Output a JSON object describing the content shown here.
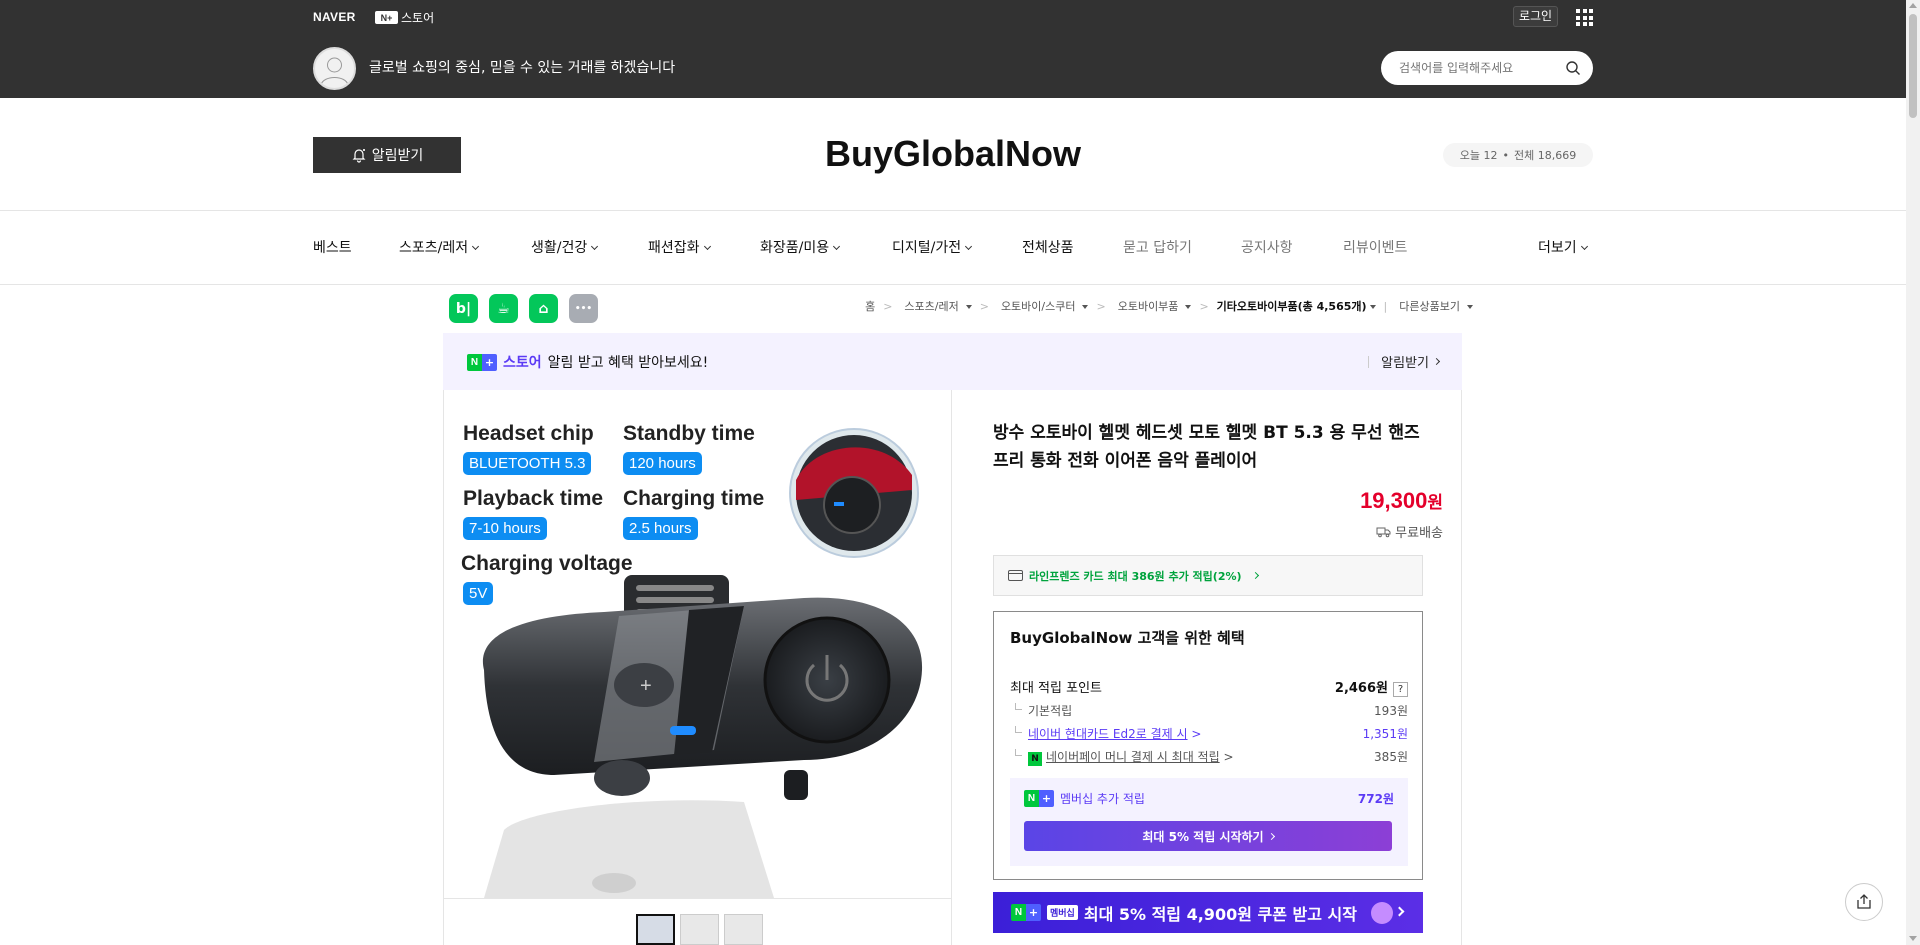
{
  "topbar": {
    "naver": "NAVER",
    "store_badge": "N+",
    "store_label": "스토어",
    "login": "로그인",
    "tagline": "글로벌 쇼핑의 중심, 믿을 수 있는 거래를 하겠습니다",
    "search_placeholder": "검색어를 입력해주세요"
  },
  "header": {
    "alarm_label": "알림받기",
    "store_name": "BuyGlobalNow",
    "visit_today": "오늘 12",
    "visit_dot": "•",
    "visit_total": "전체 18,669"
  },
  "nav": {
    "items": [
      {
        "label": "베스트"
      },
      {
        "label": "스포츠/레저"
      },
      {
        "label": "생활/건강"
      },
      {
        "label": "패션잡화"
      },
      {
        "label": "화장품/미용"
      },
      {
        "label": "디지털/가전"
      },
      {
        "label": "전체상품"
      },
      {
        "label": "묻고 답하기"
      },
      {
        "label": "공지사항"
      },
      {
        "label": "리뷰이벤트"
      }
    ],
    "more": "더보기"
  },
  "social": {
    "blog": "b|",
    "cafe": "☕",
    "bookmark": "⌂",
    "more": "•••"
  },
  "breadcrumb": {
    "items": [
      "홈",
      "스포츠/레저",
      "오토바이/스쿠터",
      "오토바이부품"
    ],
    "current": "기타오토바이부품",
    "count": "(총 4,565개)",
    "other": "다른상품보기"
  },
  "banner": {
    "store": "스토어",
    "text": "알림 받고 혜택 받아보세요!",
    "action": "알림받기"
  },
  "product_image": {
    "labels": {
      "chip": "Headset chip",
      "chip_value": "BLUETOOTH 5.3",
      "standby": "Standby time",
      "standby_value": "120 hours",
      "playback": "Playback time",
      "playback_value": "7-10 hours",
      "charging": "Charging time",
      "charging_value": "2.5 hours",
      "voltage": "Charging voltage",
      "voltage_value": "5V"
    }
  },
  "product": {
    "title": "방수 오토바이 헬멧 헤드셋 모토 헬멧 BT 5.3 용 무선 핸즈프리 통화 전화 이어폰 음악 플레이어",
    "price": "19,300",
    "price_unit": "원",
    "shipping": "무료배송",
    "card_offer": "라인프렌즈 카드 최대 386원 추가 적립(2%)"
  },
  "benefits": {
    "title": "BuyGlobalNow 고객을 위한 혜택",
    "max_points_label": "최대 적립 포인트",
    "max_points_value": "2,466원",
    "basic_label": "기본적립",
    "basic_value": "193원",
    "card_label": "네이버 현대카드 Ed2로 결제 시",
    "card_value": "1,351원",
    "pay_label": "네이버페이 머니 결제 시 최대 적립",
    "pay_value": "385원",
    "membership_label": "멤버십 추가 적립",
    "membership_value": "772원",
    "membership_btn": "최대 5% 적립 시작하기"
  },
  "promo": {
    "tag": "멤버십",
    "text": "최대 5% 적립 4,900원 쿠폰 받고 시작"
  },
  "colors": {
    "topbar": "#323232",
    "price": "#e4002b",
    "naver_green": "#00c73c",
    "accent_purple": "#5b3bf5",
    "spec_blue": "#0d8df2"
  }
}
